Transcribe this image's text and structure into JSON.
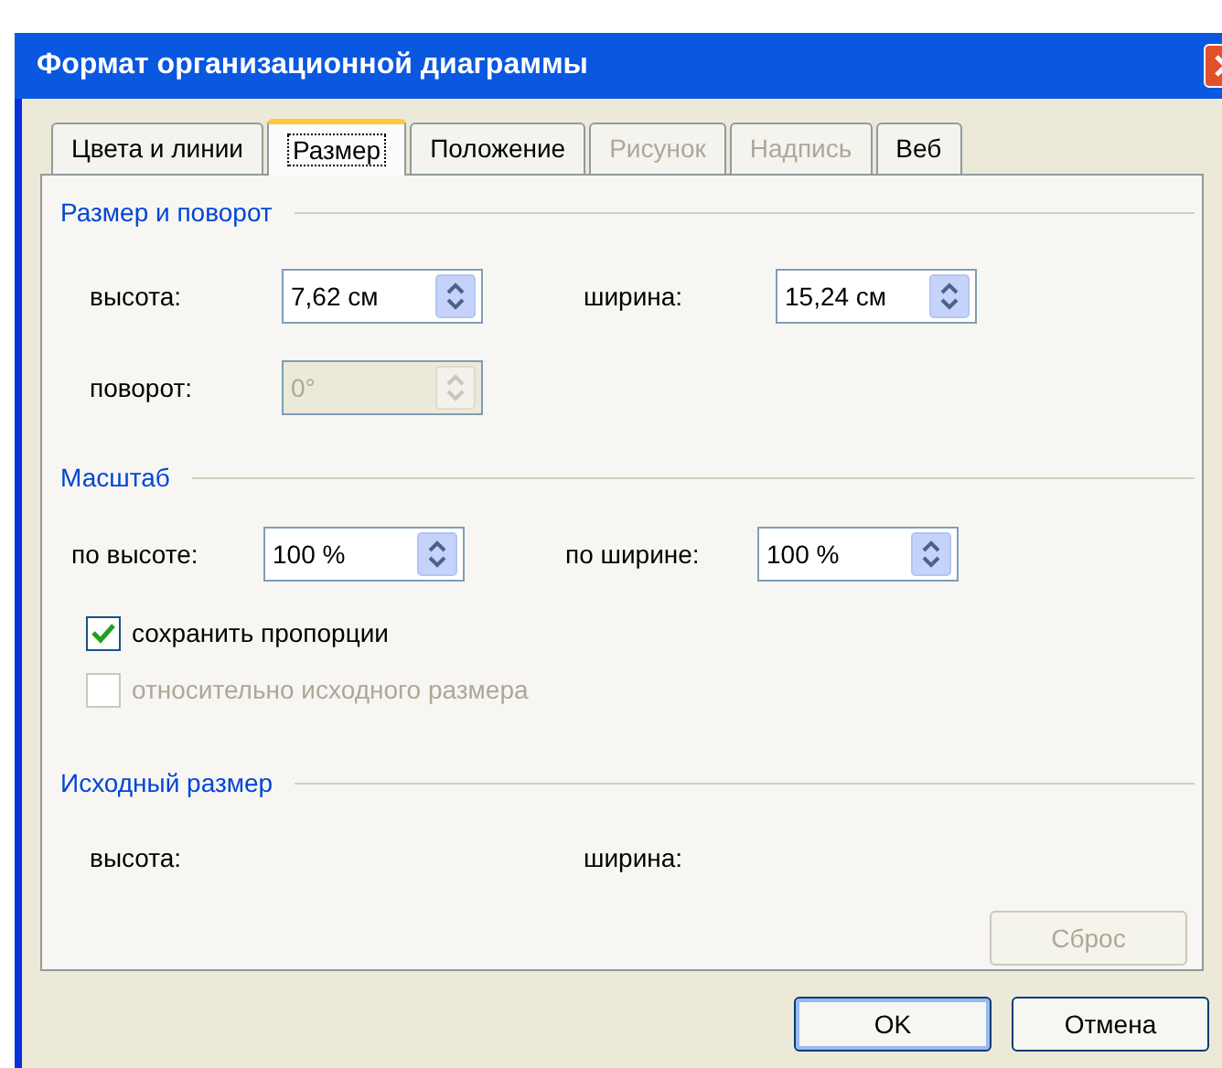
{
  "window": {
    "title": "Формат организационной диаграммы"
  },
  "tabs": [
    {
      "label": "Цвета и линии",
      "selected": false,
      "disabled": false
    },
    {
      "label": "Размер",
      "selected": true,
      "disabled": false
    },
    {
      "label": "Положение",
      "selected": false,
      "disabled": false
    },
    {
      "label": "Рисунок",
      "selected": false,
      "disabled": true
    },
    {
      "label": "Надпись",
      "selected": false,
      "disabled": true
    },
    {
      "label": "Веб",
      "selected": false,
      "disabled": false
    }
  ],
  "size_rotation": {
    "title": "Размер и поворот",
    "rows": [
      [
        {
          "label": "высота:",
          "value": "7,62 см",
          "disabled": false
        },
        {
          "label": "ширина:",
          "value": "15,24 см",
          "disabled": false
        }
      ],
      [
        {
          "label": "поворот:",
          "value": "0°",
          "disabled": true
        }
      ]
    ]
  },
  "scale": {
    "title": "Масштаб",
    "rows": [
      [
        {
          "label": "по высоте:",
          "value": "100 %",
          "disabled": false
        },
        {
          "label": "по ширине:",
          "value": "100 %",
          "disabled": false
        }
      ]
    ],
    "checkboxes": [
      {
        "label": "сохранить пропорции",
        "checked": true,
        "disabled": false
      },
      {
        "label": "относительно исходного размера",
        "checked": false,
        "disabled": true
      }
    ]
  },
  "original_size": {
    "title": "Исходный размер",
    "labels": [
      "высота:",
      "ширина:"
    ],
    "reset_button": {
      "label": "Сброс",
      "disabled": true
    }
  },
  "buttons": [
    {
      "label": "OK",
      "default": true
    },
    {
      "label": "Отмена",
      "default": false
    }
  ]
}
